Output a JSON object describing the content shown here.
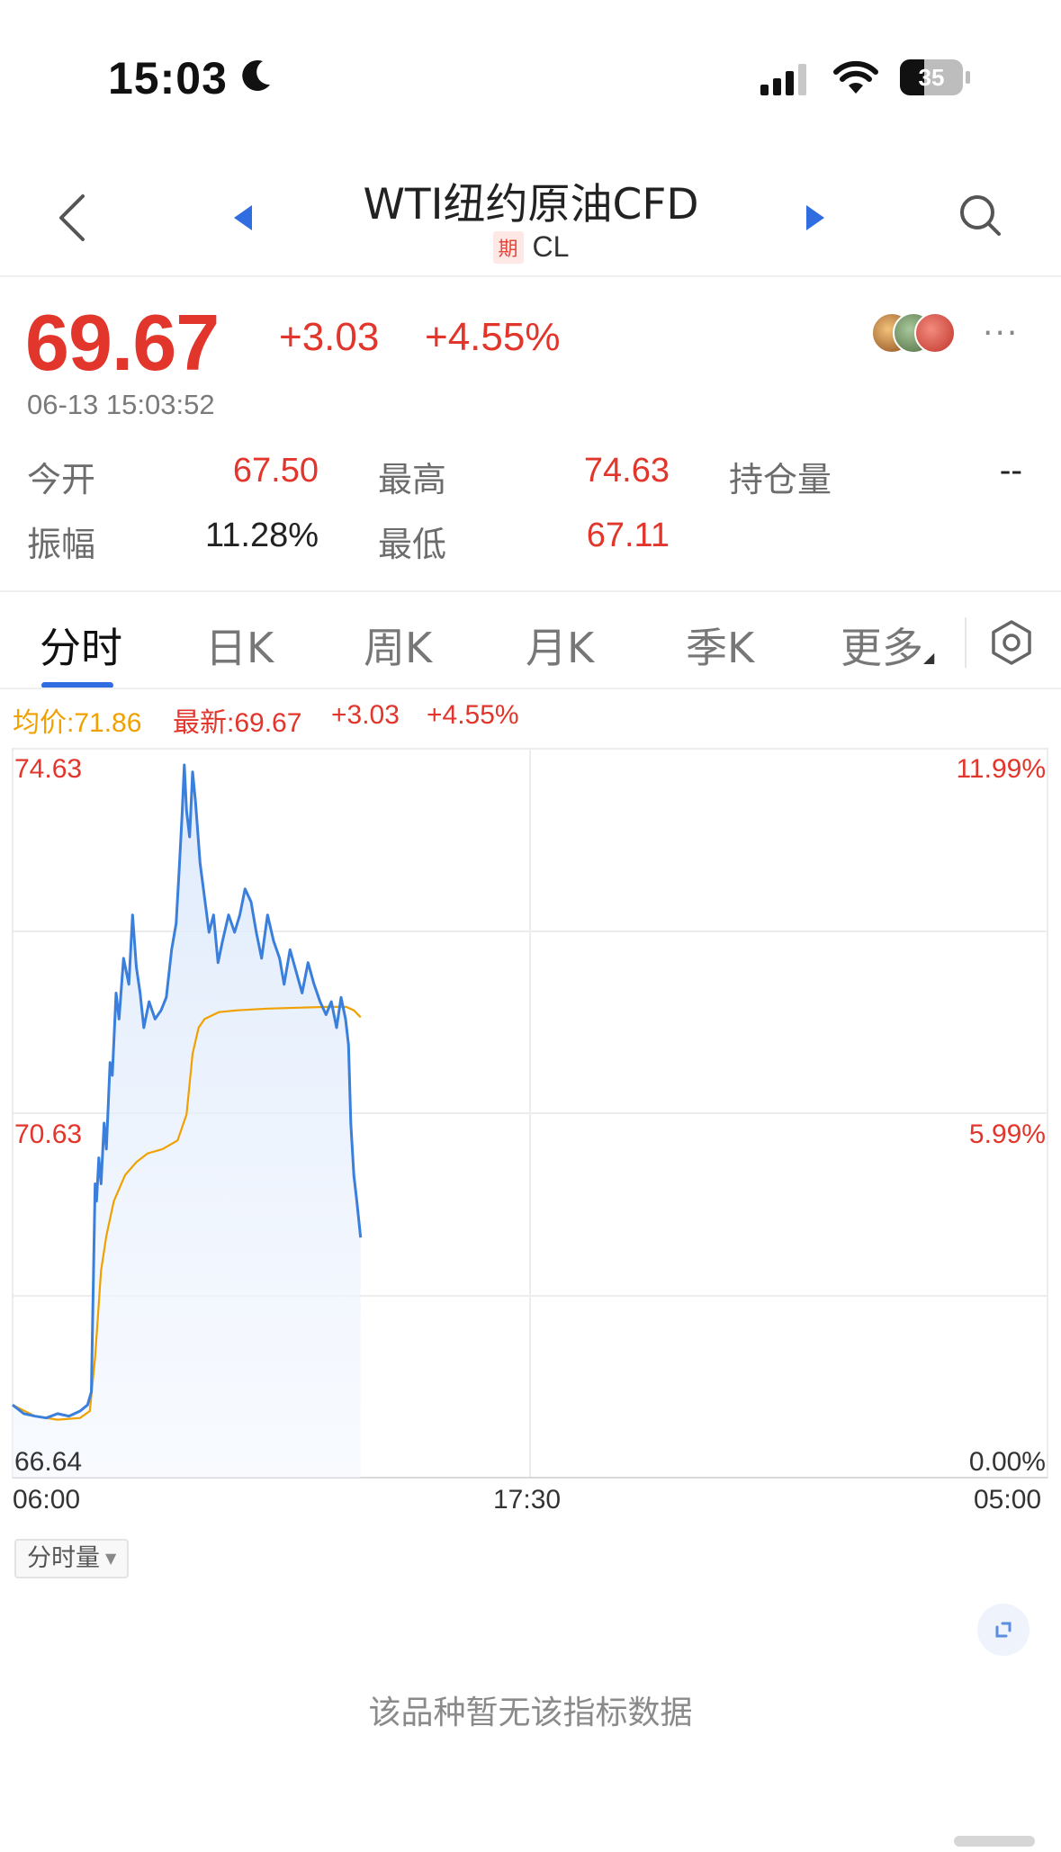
{
  "status_bar": {
    "time": "15:03",
    "battery": "35"
  },
  "header": {
    "title": "WTI纽约原油CFD",
    "tag": "期",
    "code": "CL"
  },
  "quote": {
    "price": "69.67",
    "change": "+3.03",
    "change_pct": "+4.55%",
    "datetime": "06-13 15:03:52",
    "stats": [
      {
        "label": "今开",
        "value": "67.50"
      },
      {
        "label": "最高",
        "value": "74.63"
      },
      {
        "label": "持仓量",
        "value": "--"
      },
      {
        "label": "振幅",
        "value": "11.28%"
      },
      {
        "label": "最低",
        "value": "67.11"
      }
    ]
  },
  "tabs": [
    "分时",
    "日K",
    "周K",
    "月K",
    "季K",
    "更多"
  ],
  "legend": {
    "avg": "均价:71.86",
    "last": "最新:69.67",
    "change": "+3.03",
    "change_pct": "+4.55%"
  },
  "chart_data": {
    "type": "line",
    "y_left_ticks": [
      "74.63",
      "70.63",
      "66.64"
    ],
    "y_right_ticks": [
      "11.99%",
      "5.99%",
      "0.00%"
    ],
    "x_ticks": [
      "06:00",
      "17:30",
      "05:00"
    ],
    "ylim": [
      66.64,
      74.63
    ],
    "session_minutes": 1380,
    "series": [
      {
        "color": "#3a7fdc",
        "points": [
          [
            0,
            67.25
          ],
          [
            15,
            67.15
          ],
          [
            30,
            67.12
          ],
          [
            45,
            67.1
          ],
          [
            60,
            67.15
          ],
          [
            75,
            67.12
          ],
          [
            90,
            67.18
          ],
          [
            100,
            67.25
          ],
          [
            105,
            67.4
          ],
          [
            110,
            69.8
          ],
          [
            112,
            69.6
          ],
          [
            115,
            70.1
          ],
          [
            118,
            69.8
          ],
          [
            122,
            70.5
          ],
          [
            125,
            70.2
          ],
          [
            130,
            71.2
          ],
          [
            133,
            71.05
          ],
          [
            138,
            72.0
          ],
          [
            142,
            71.7
          ],
          [
            148,
            72.4
          ],
          [
            155,
            72.1
          ],
          [
            160,
            72.9
          ],
          [
            165,
            72.3
          ],
          [
            170,
            72.0
          ],
          [
            175,
            71.6
          ],
          [
            182,
            71.9
          ],
          [
            190,
            71.7
          ],
          [
            198,
            71.8
          ],
          [
            205,
            71.95
          ],
          [
            212,
            72.5
          ],
          [
            218,
            72.8
          ],
          [
            222,
            73.4
          ],
          [
            226,
            74.05
          ],
          [
            229,
            74.63
          ],
          [
            232,
            74.1
          ],
          [
            236,
            73.8
          ],
          [
            240,
            74.55
          ],
          [
            244,
            74.2
          ],
          [
            250,
            73.5
          ],
          [
            256,
            73.1
          ],
          [
            262,
            72.7
          ],
          [
            268,
            72.9
          ],
          [
            274,
            72.35
          ],
          [
            280,
            72.6
          ],
          [
            288,
            72.9
          ],
          [
            296,
            72.7
          ],
          [
            303,
            72.9
          ],
          [
            310,
            73.2
          ],
          [
            318,
            73.05
          ],
          [
            325,
            72.7
          ],
          [
            332,
            72.4
          ],
          [
            340,
            72.9
          ],
          [
            348,
            72.6
          ],
          [
            356,
            72.4
          ],
          [
            362,
            72.1
          ],
          [
            370,
            72.5
          ],
          [
            378,
            72.25
          ],
          [
            386,
            72.0
          ],
          [
            394,
            72.35
          ],
          [
            402,
            72.1
          ],
          [
            410,
            71.9
          ],
          [
            418,
            71.75
          ],
          [
            425,
            71.9
          ],
          [
            432,
            71.6
          ],
          [
            438,
            71.95
          ],
          [
            444,
            71.7
          ],
          [
            448,
            71.4
          ],
          [
            451,
            70.5
          ],
          [
            455,
            69.9
          ],
          [
            459,
            69.6
          ],
          [
            462,
            69.35
          ],
          [
            464,
            69.18
          ]
        ]
      },
      {
        "color": "#f0a100",
        "points": [
          [
            0,
            67.25
          ],
          [
            30,
            67.12
          ],
          [
            60,
            67.08
          ],
          [
            90,
            67.1
          ],
          [
            103,
            67.18
          ],
          [
            110,
            67.8
          ],
          [
            118,
            68.8
          ],
          [
            125,
            69.2
          ],
          [
            135,
            69.6
          ],
          [
            150,
            69.9
          ],
          [
            165,
            70.05
          ],
          [
            180,
            70.15
          ],
          [
            200,
            70.2
          ],
          [
            220,
            70.3
          ],
          [
            232,
            70.6
          ],
          [
            240,
            71.3
          ],
          [
            248,
            71.6
          ],
          [
            256,
            71.7
          ],
          [
            275,
            71.78
          ],
          [
            300,
            71.8
          ],
          [
            340,
            71.82
          ],
          [
            380,
            71.83
          ],
          [
            420,
            71.84
          ],
          [
            445,
            71.84
          ],
          [
            455,
            71.8
          ],
          [
            464,
            71.72
          ]
        ]
      }
    ]
  },
  "indicator": {
    "selector_label": "分时量",
    "no_data": "该品种暂无该指标数据"
  }
}
